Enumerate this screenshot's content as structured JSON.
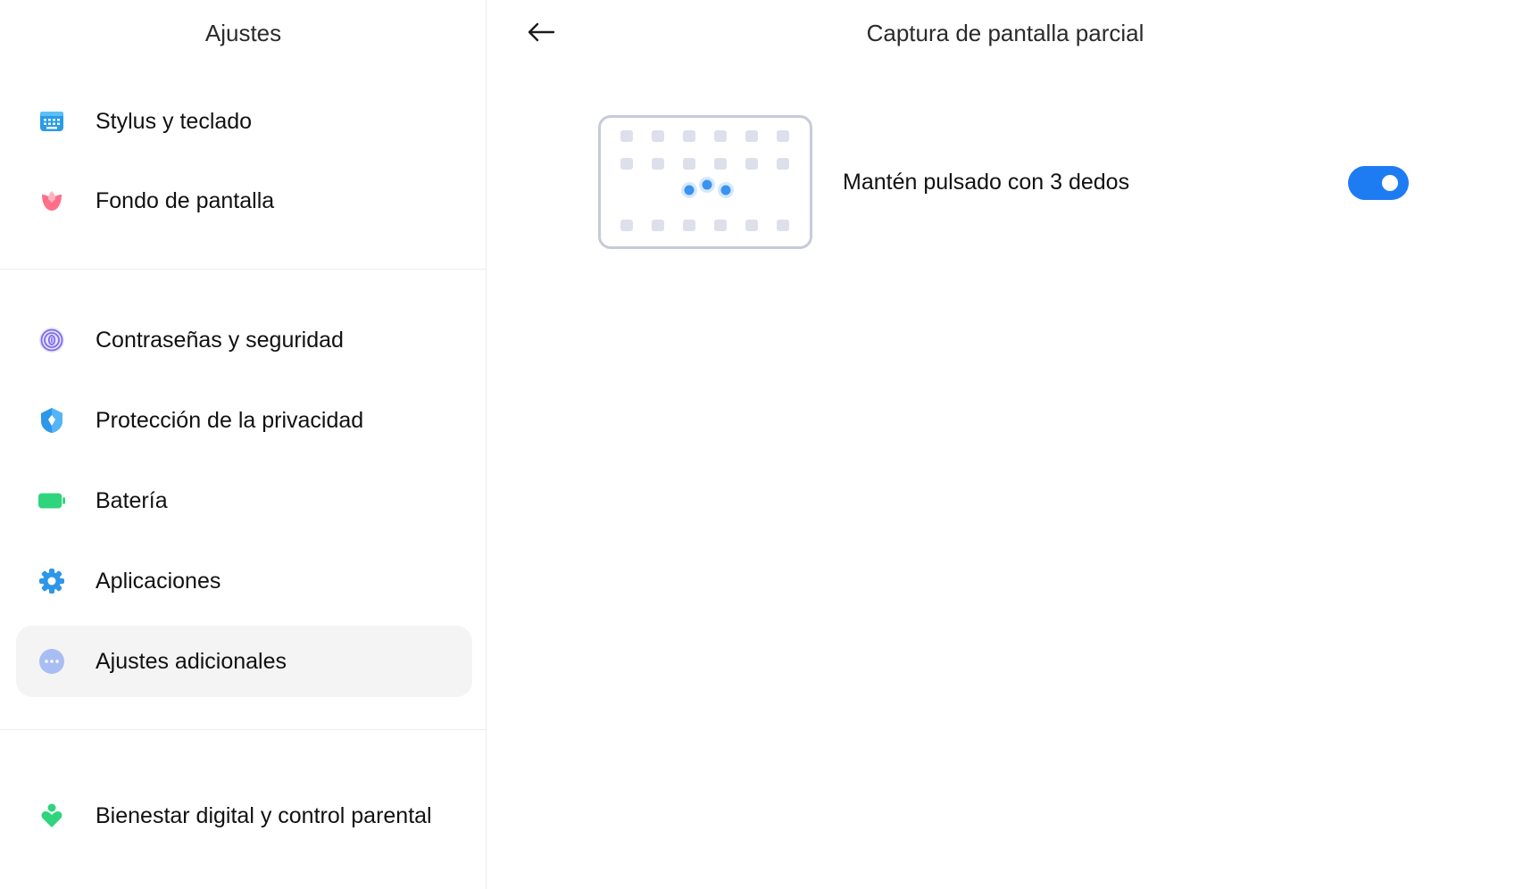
{
  "left_pane": {
    "title": "Ajustes",
    "items": [
      {
        "label": "Stylus y teclado",
        "icon": "keyboard-icon"
      },
      {
        "label": "Fondo de pantalla",
        "icon": "wallpaper-icon"
      },
      {
        "label": "Contraseñas y seguridad",
        "icon": "fingerprint-icon"
      },
      {
        "label": "Protección de la privacidad",
        "icon": "privacy-shield-icon"
      },
      {
        "label": "Batería",
        "icon": "battery-icon"
      },
      {
        "label": "Aplicaciones",
        "icon": "apps-gear-icon"
      },
      {
        "label": "Ajustes adicionales",
        "icon": "more-dots-icon",
        "selected": true
      },
      {
        "label": "Bienestar digital y control parental",
        "icon": "wellbeing-icon"
      }
    ]
  },
  "detail": {
    "title": "Captura de pantalla parcial",
    "setting_label": "Mantén pulsado con 3 dedos",
    "toggle_on": true
  },
  "colors": {
    "accent": "#1e7cf2",
    "selected_bg": "#f4f4f5",
    "divider": "#ececec"
  }
}
